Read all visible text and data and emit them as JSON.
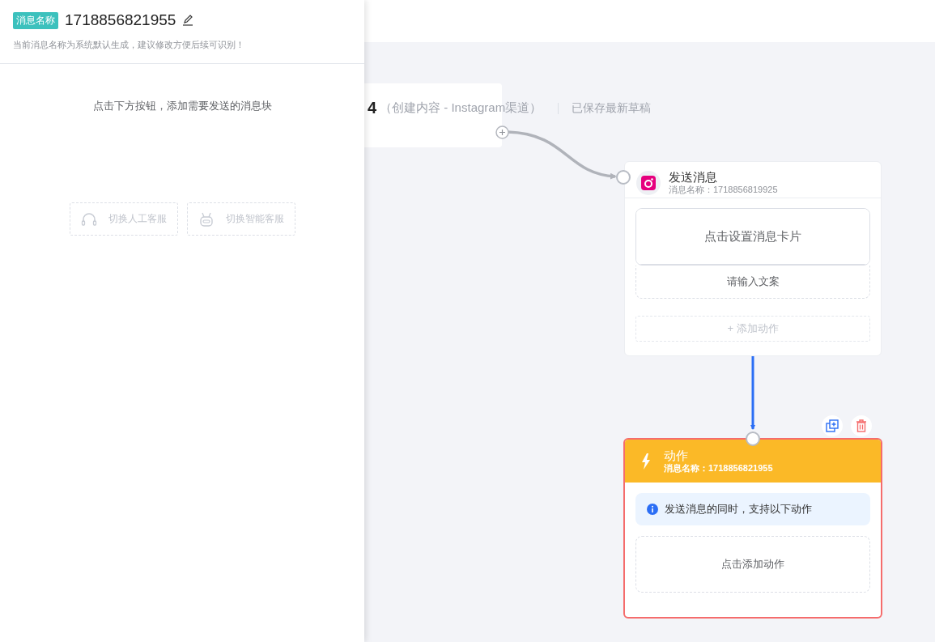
{
  "canvas": {
    "header": {
      "title": "4",
      "subtitle": "（创建内容 - Instagram渠道）",
      "status": "已保存最新草稿"
    },
    "send_node": {
      "title": "发送消息",
      "name_label": "消息名称：1718856819925",
      "card_prompt": "点击设置消息卡片",
      "text_placeholder": "请输入文案",
      "add_action": "+ 添加动作",
      "selected": false
    },
    "action_node": {
      "title": "动作",
      "name_label": "消息名称：1718856821955",
      "info": "发送消息的同时，支持以下动作",
      "add_prompt": "点击添加动作",
      "selected": true
    }
  },
  "drawer": {
    "tag": "消息名称",
    "name": "1718856821955",
    "hint": "当前消息名称为系统默认生成，建议修改方便后续可识别！",
    "prompt": "点击下方按钮，添加需要发送的消息块",
    "buttons": [
      {
        "label": "切换人工客服",
        "kind": "headset",
        "disabled": true
      },
      {
        "label": "切换智能客服",
        "kind": "robot",
        "disabled": true
      }
    ]
  }
}
